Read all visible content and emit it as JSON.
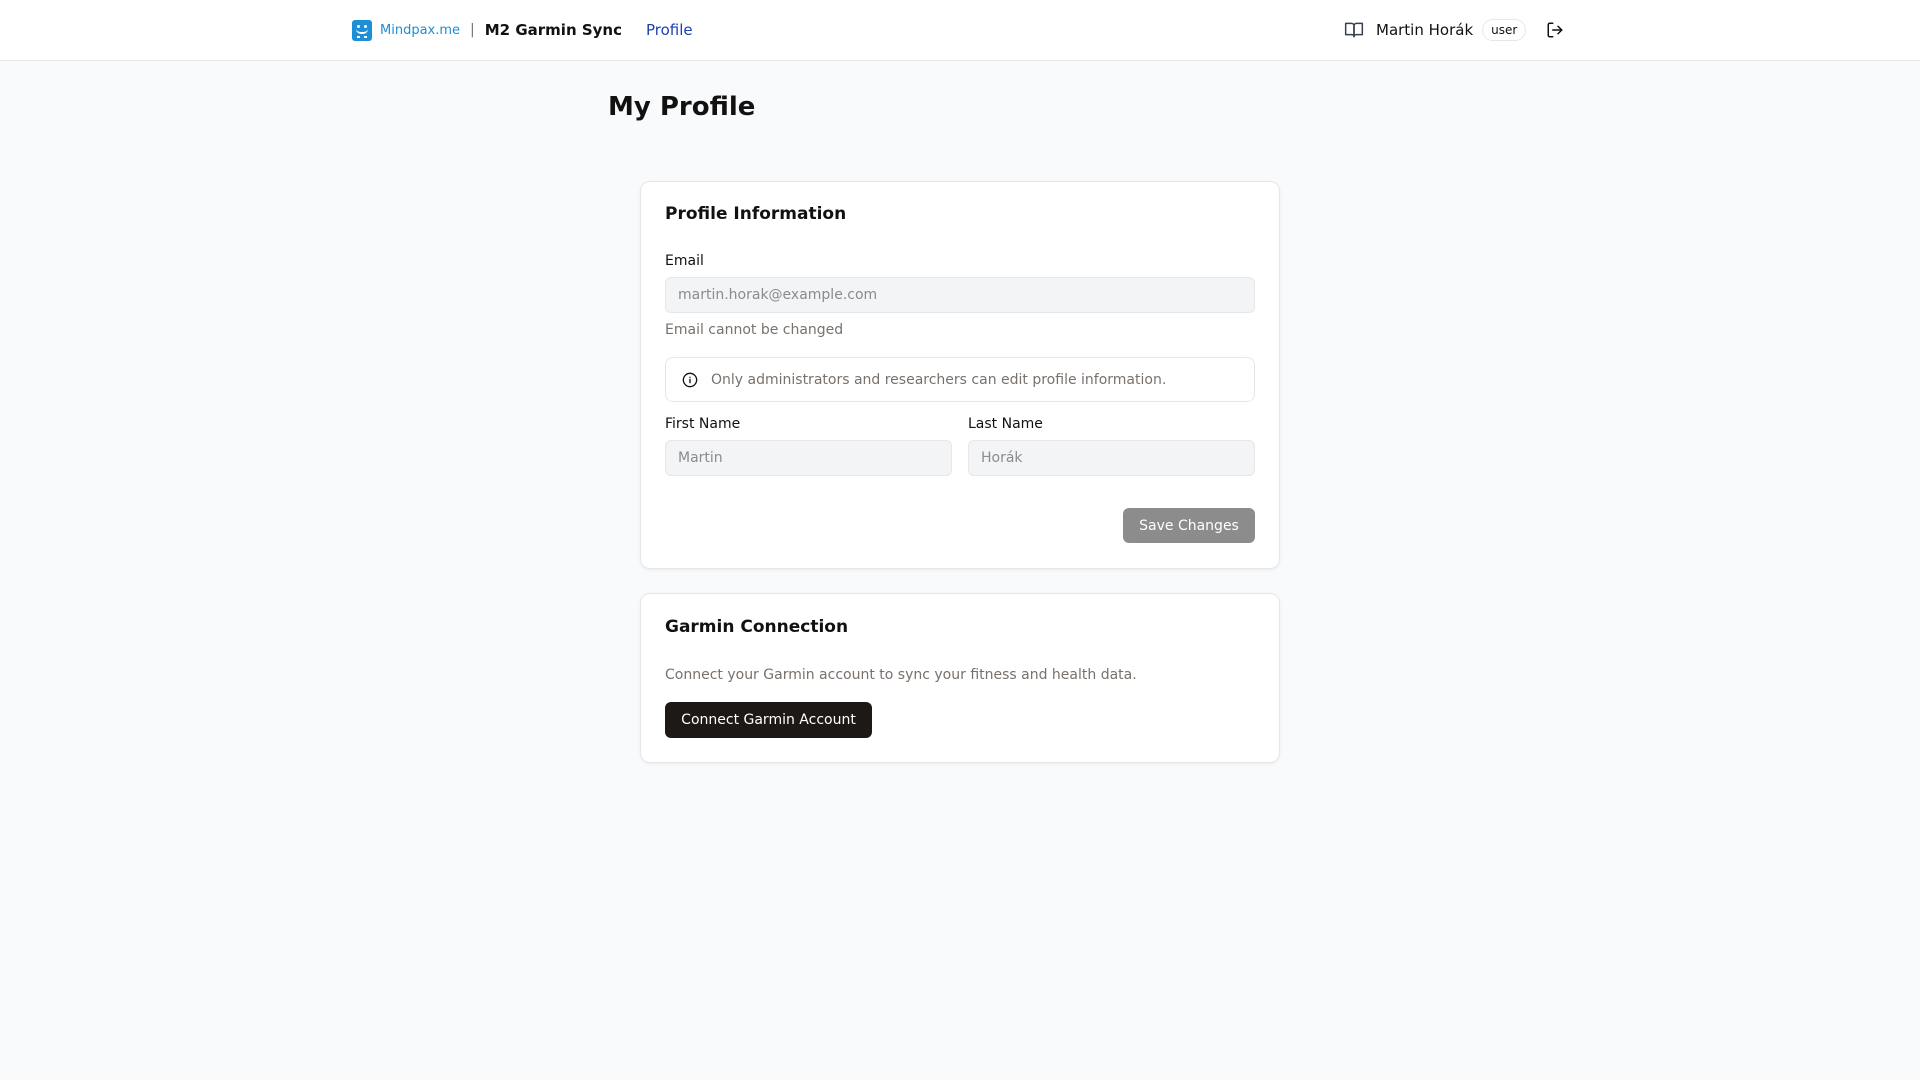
{
  "header": {
    "brand": "Mindpax.me",
    "separator": "|",
    "app_name": "M2 Garmin Sync",
    "nav_profile": "Profile",
    "user_name": "Martin Horák",
    "role": "user",
    "icons": {
      "logo": "mindpax-logo-icon",
      "docs": "book-icon",
      "logout": "logout-icon"
    }
  },
  "page": {
    "title": "My Profile"
  },
  "profile_card": {
    "title": "Profile Information",
    "email_label": "Email",
    "email_value": "martin.horak@example.com",
    "email_help": "Email cannot be changed",
    "notice": "Only administrators and researchers can edit profile information.",
    "first_name_label": "First Name",
    "first_name_value": "Martin",
    "last_name_label": "Last Name",
    "last_name_value": "Horák",
    "save_label": "Save Changes"
  },
  "garmin_card": {
    "title": "Garmin Connection",
    "description": "Connect your Garmin account to sync your fitness and health data.",
    "connect_label": "Connect Garmin Account"
  },
  "colors": {
    "brand": "#1d8fd6",
    "nav_link": "#1e40af",
    "primary_button": "#1c1917",
    "disabled_button": "#8c8c8c"
  }
}
